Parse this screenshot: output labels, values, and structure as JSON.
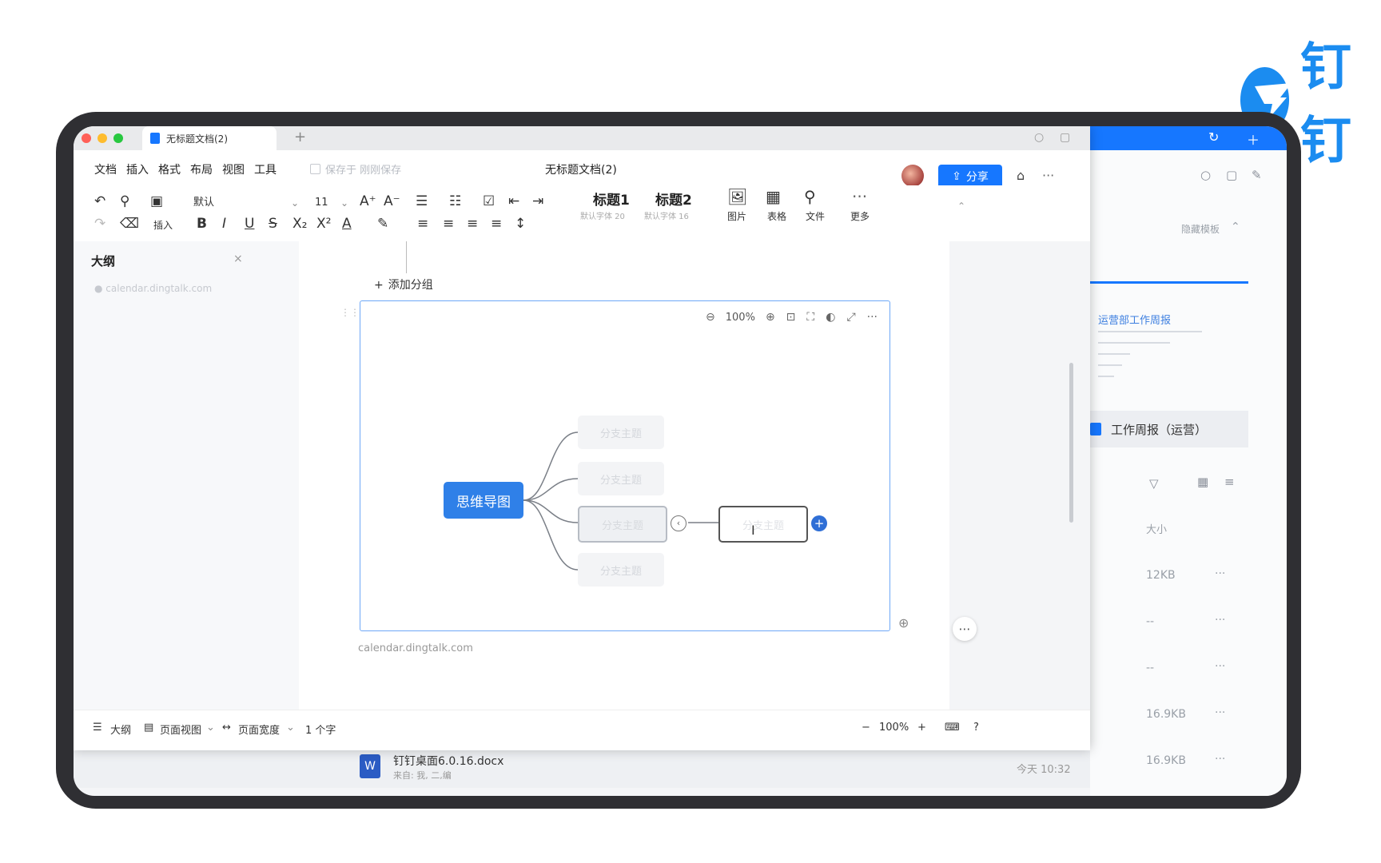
{
  "brand": {
    "text": "钉钉"
  },
  "colors": {
    "accent": "#1677ff",
    "frame": "#2f2f33",
    "root_node": "#2f80e8"
  },
  "window": {
    "tab_title": "无标题文档(2)",
    "doc_title": "无标题文档(2)",
    "menu": [
      "文档",
      "插入",
      "格式",
      "布局",
      "视图",
      "工具"
    ],
    "autosave_label": "保存于 刚刚保存",
    "share_label": "分享"
  },
  "toolbar": {
    "font_name": "默认",
    "font_size": "11",
    "insert_label": "插入",
    "styles": [
      {
        "name": "标题1",
        "sub": "默认字体 20"
      },
      {
        "name": "标题2",
        "sub": "默认字体 16"
      }
    ],
    "insert_items": [
      "图片",
      "表格",
      "文件",
      "更多"
    ]
  },
  "outline": {
    "title": "大纲",
    "item": "● calendar.dingtalk.com"
  },
  "document": {
    "add_group": "添加分组",
    "url_text": "calendar.dingtalk.com",
    "mindmap": {
      "zoom": "100%",
      "root": "思维导图",
      "children": [
        "分支主题",
        "分支主题",
        "分支主题",
        "分支主题"
      ],
      "editing_node": "分支主题"
    }
  },
  "statusbar": {
    "outline": "大纲",
    "page_view": "页面视图",
    "page_width": "页面宽度",
    "word_count": "1 个字",
    "zoom": "100%"
  },
  "back_app": {
    "hide_label": "隐藏模板",
    "card_title": "运营部工作周报",
    "selected_doc": "工作周报（运营）",
    "size_header": "大小",
    "sizes": [
      "12KB",
      "--",
      "--",
      "16.9KB",
      "16.9KB"
    ],
    "file_name": "钉钉桌面6.0.16.docx",
    "file_sub": "来自: 我, 二,编",
    "file_time": "今天 10:32"
  }
}
